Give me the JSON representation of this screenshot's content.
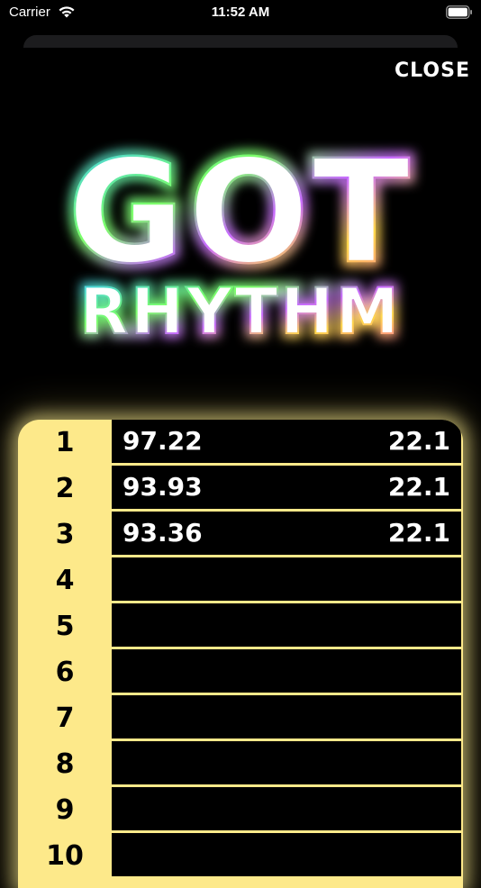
{
  "status_bar": {
    "carrier": "Carrier",
    "time": "11:52 AM"
  },
  "header": {
    "close_label": "CLOSE"
  },
  "logo": {
    "line1": "GOT",
    "line2": "RHYTHM"
  },
  "leaderboard": {
    "entries": [
      {
        "rank": "1",
        "score": "97.22",
        "time": "22.1"
      },
      {
        "rank": "2",
        "score": "93.93",
        "time": "22.1"
      },
      {
        "rank": "3",
        "score": "93.36",
        "time": "22.1"
      },
      {
        "rank": "4",
        "score": "",
        "time": ""
      },
      {
        "rank": "5",
        "score": "",
        "time": ""
      },
      {
        "rank": "6",
        "score": "",
        "time": ""
      },
      {
        "rank": "7",
        "score": "",
        "time": ""
      },
      {
        "rank": "8",
        "score": "",
        "time": ""
      },
      {
        "rank": "9",
        "score": "",
        "time": ""
      },
      {
        "rank": "10",
        "score": "",
        "time": ""
      }
    ]
  },
  "colors": {
    "background": "#000000",
    "panel": "#fde98a",
    "glow_blue": "#39c6ff",
    "glow_green": "#7dff6a",
    "glow_purple": "#c86bff",
    "glow_yellow": "#ffd84a",
    "glow_pink": "#ff6fa8"
  }
}
